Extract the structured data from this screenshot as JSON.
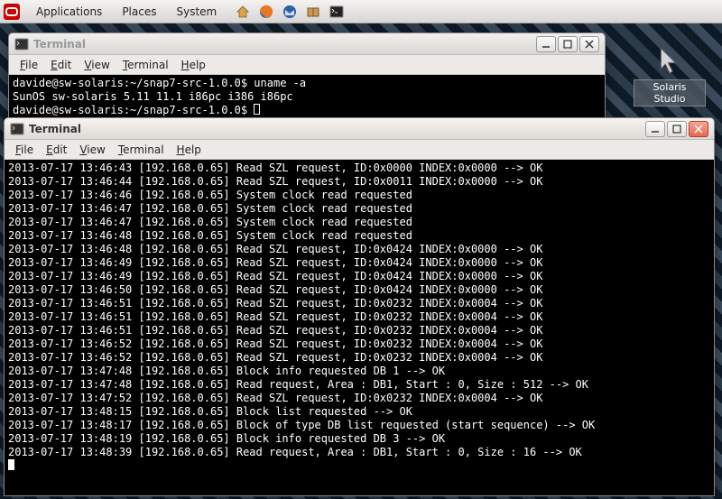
{
  "taskbar": {
    "menus": [
      "Applications",
      "Places",
      "System"
    ]
  },
  "desktop": {
    "solaris_studio": "Solaris Studio"
  },
  "window1": {
    "title": "Terminal",
    "menus": {
      "file": "File",
      "edit": "Edit",
      "view": "View",
      "terminal": "Terminal",
      "help": "Help"
    },
    "lines": [
      "davide@sw-solaris:~/snap7-src-1.0.0$ uname -a",
      "SunOS sw-solaris 5.11 11.1 i86pc i386 i86pc",
      "davide@sw-solaris:~/snap7-src-1.0.0$ "
    ]
  },
  "window2": {
    "title": "Terminal",
    "menus": {
      "file": "File",
      "edit": "Edit",
      "view": "View",
      "terminal": "Terminal",
      "help": "Help"
    },
    "lines": [
      "2013-07-17 13:46:43 [192.168.0.65] Read SZL request, ID:0x0000 INDEX:0x0000 --> OK",
      "2013-07-17 13:46:44 [192.168.0.65] Read SZL request, ID:0x0011 INDEX:0x0000 --> OK",
      "2013-07-17 13:46:46 [192.168.0.65] System clock read requested",
      "2013-07-17 13:46:47 [192.168.0.65] System clock read requested",
      "2013-07-17 13:46:47 [192.168.0.65] System clock read requested",
      "2013-07-17 13:46:48 [192.168.0.65] System clock read requested",
      "2013-07-17 13:46:48 [192.168.0.65] Read SZL request, ID:0x0424 INDEX:0x0000 --> OK",
      "2013-07-17 13:46:49 [192.168.0.65] Read SZL request, ID:0x0424 INDEX:0x0000 --> OK",
      "2013-07-17 13:46:49 [192.168.0.65] Read SZL request, ID:0x0424 INDEX:0x0000 --> OK",
      "2013-07-17 13:46:50 [192.168.0.65] Read SZL request, ID:0x0424 INDEX:0x0000 --> OK",
      "2013-07-17 13:46:51 [192.168.0.65] Read SZL request, ID:0x0232 INDEX:0x0004 --> OK",
      "2013-07-17 13:46:51 [192.168.0.65] Read SZL request, ID:0x0232 INDEX:0x0004 --> OK",
      "2013-07-17 13:46:51 [192.168.0.65] Read SZL request, ID:0x0232 INDEX:0x0004 --> OK",
      "2013-07-17 13:46:52 [192.168.0.65] Read SZL request, ID:0x0232 INDEX:0x0004 --> OK",
      "2013-07-17 13:46:52 [192.168.0.65] Read SZL request, ID:0x0232 INDEX:0x0004 --> OK",
      "2013-07-17 13:47:48 [192.168.0.65] Block info requested DB 1 --> OK",
      "2013-07-17 13:47:48 [192.168.0.65] Read request, Area : DB1, Start : 0, Size : 512 --> OK",
      "2013-07-17 13:47:52 [192.168.0.65] Read SZL request, ID:0x0232 INDEX:0x0004 --> OK",
      "2013-07-17 13:48:15 [192.168.0.65] Block list requested --> OK",
      "2013-07-17 13:48:17 [192.168.0.65] Block of type DB list requested (start sequence) --> OK",
      "2013-07-17 13:48:19 [192.168.0.65] Block info requested DB 3 --> OK",
      "2013-07-17 13:48:39 [192.168.0.65] Read request, Area : DB1, Start : 0, Size : 16 --> OK"
    ]
  }
}
